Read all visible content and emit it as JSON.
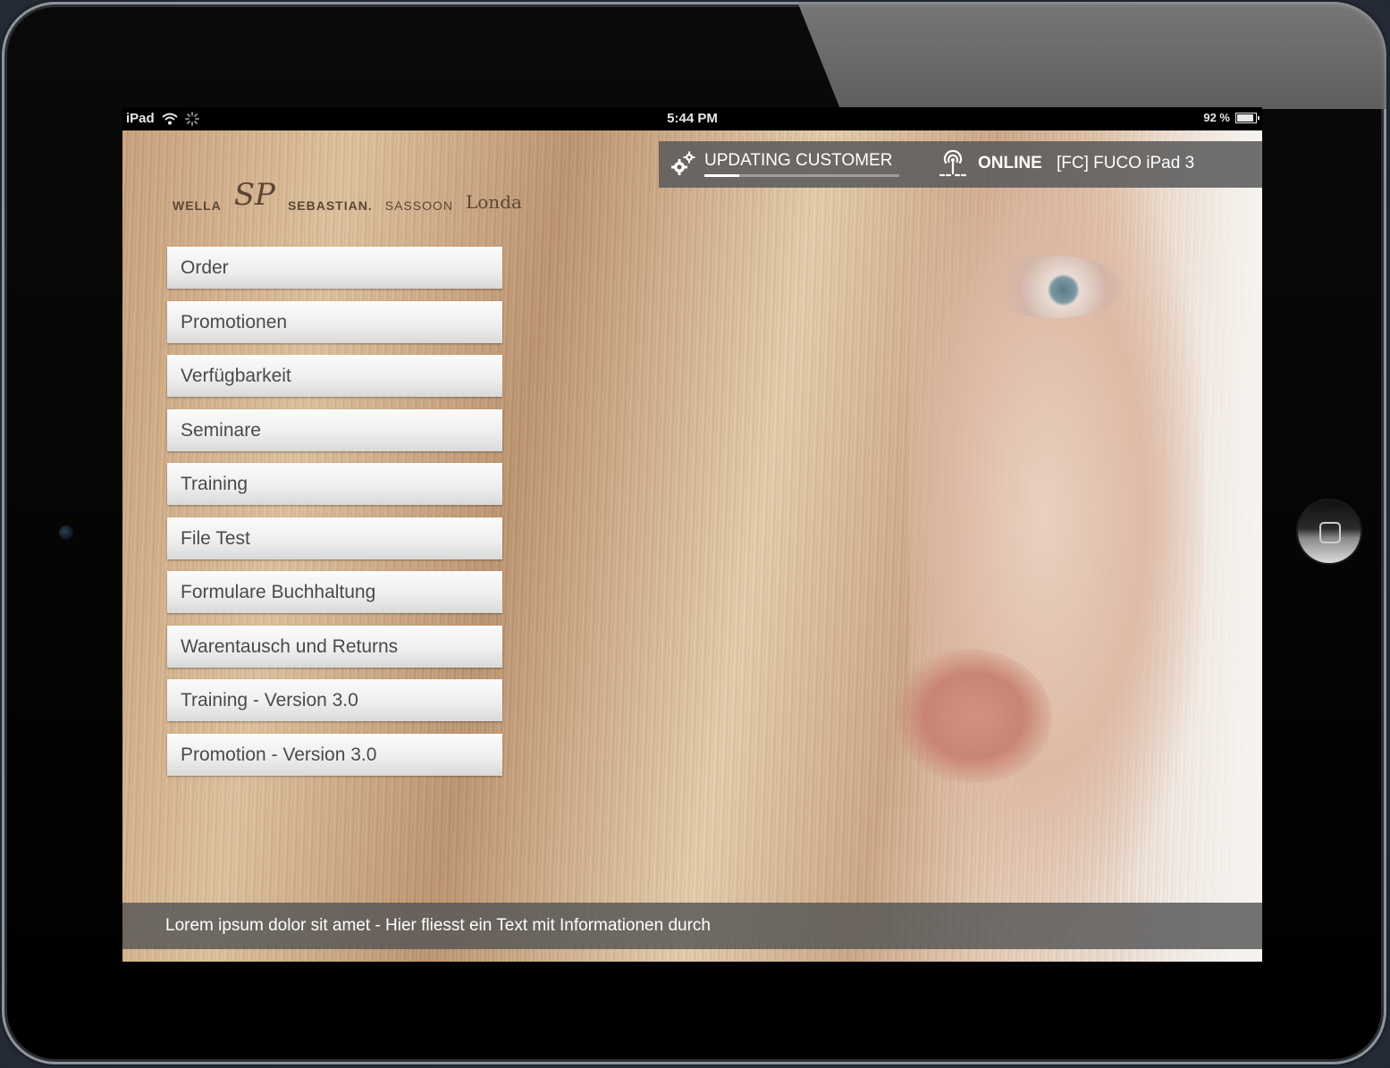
{
  "status_bar": {
    "device": "iPad",
    "time": "5:44 PM",
    "battery": "92 %",
    "battery_level": 0.92
  },
  "brands": [
    "WELLA",
    "SP",
    "SEBASTIAN.",
    "SASSOON",
    "Londa"
  ],
  "menu": {
    "items": [
      {
        "label": "Order"
      },
      {
        "label": "Promotionen"
      },
      {
        "label": "Verfügbarkeit"
      },
      {
        "label": "Seminare"
      },
      {
        "label": "Training"
      },
      {
        "label": "File Test"
      },
      {
        "label": "Formulare Buchhaltung"
      },
      {
        "label": "Warentausch und Returns"
      },
      {
        "label": "Training - Version 3.0"
      },
      {
        "label": "Promotion - Version 3.0"
      }
    ]
  },
  "sync": {
    "status_label": "UPDATING CUSTOMER",
    "progress": 0.18,
    "connection": "ONLINE",
    "device_name": "[FC] FUCO iPad 3"
  },
  "ticker": {
    "text": "Lorem ipsum dolor sit amet - Hier fliesst ein Text mit Informationen durch"
  },
  "icons": [
    "wifi-icon",
    "activity-spinner-icon",
    "battery-icon",
    "gears-icon",
    "antenna-icon",
    "home-square-icon"
  ]
}
